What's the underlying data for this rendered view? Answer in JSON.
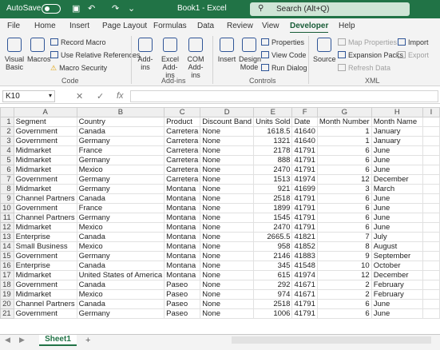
{
  "titlebar": {
    "autosave": "AutoSave",
    "toggle": "Off",
    "book": "Book1 - Excel",
    "search": "Search (Alt+Q)"
  },
  "tabs": [
    "File",
    "Home",
    "Insert",
    "Page Layout",
    "Formulas",
    "Data",
    "Review",
    "View",
    "Developer",
    "Help"
  ],
  "ribbon": {
    "code": {
      "vb": "Visual Basic",
      "macros": "Macros",
      "record": "Record Macro",
      "relative": "Use Relative References",
      "security": "Macro Security",
      "group": "Code"
    },
    "addins": {
      "addins": "Add-ins",
      "excel": "Excel Add-ins",
      "com": "COM Add-ins",
      "group": "Add-ins"
    },
    "controls": {
      "insert": "Insert",
      "design": "Design Mode",
      "properties": "Properties",
      "viewcode": "View Code",
      "rundialog": "Run Dialog",
      "group": "Controls"
    },
    "xml": {
      "source": "Source",
      "mapprops": "Map Properties",
      "expansion": "Expansion Packs",
      "refresh": "Refresh Data",
      "import": "Import",
      "export": "Export",
      "group": "XML"
    }
  },
  "formula_bar": {
    "namebox": "K10",
    "fx": "fx",
    "value": ""
  },
  "columns": [
    "A",
    "B",
    "C",
    "D",
    "E",
    "F",
    "G",
    "H",
    "I"
  ],
  "header_row": [
    "Segment",
    "Country",
    "Product",
    "Discount Band",
    "Units Sold",
    "Date",
    "Month Number",
    "Month Name"
  ],
  "rows": [
    [
      "Government",
      "Canada",
      "Carretera",
      "None",
      "1618.5",
      "41640",
      "1",
      "January"
    ],
    [
      "Government",
      "Germany",
      "Carretera",
      "None",
      "1321",
      "41640",
      "1",
      "January"
    ],
    [
      "Midmarket",
      "France",
      "Carretera",
      "None",
      "2178",
      "41791",
      "6",
      "June"
    ],
    [
      "Midmarket",
      "Germany",
      "Carretera",
      "None",
      "888",
      "41791",
      "6",
      "June"
    ],
    [
      "Midmarket",
      "Mexico",
      "Carretera",
      "None",
      "2470",
      "41791",
      "6",
      "June"
    ],
    [
      "Government",
      "Germany",
      "Carretera",
      "None",
      "1513",
      "41974",
      "12",
      "December"
    ],
    [
      "Midmarket",
      "Germany",
      "Montana",
      "None",
      "921",
      "41699",
      "3",
      "March"
    ],
    [
      "Channel Partners",
      "Canada",
      "Montana",
      "None",
      "2518",
      "41791",
      "6",
      "June"
    ],
    [
      "Government",
      "France",
      "Montana",
      "None",
      "1899",
      "41791",
      "6",
      "June"
    ],
    [
      "Channel Partners",
      "Germany",
      "Montana",
      "None",
      "1545",
      "41791",
      "6",
      "June"
    ],
    [
      "Midmarket",
      "Mexico",
      "Montana",
      "None",
      "2470",
      "41791",
      "6",
      "June"
    ],
    [
      "Enterprise",
      "Canada",
      "Montana",
      "None",
      "2665.5",
      "41821",
      "7",
      "July"
    ],
    [
      "Small Business",
      "Mexico",
      "Montana",
      "None",
      "958",
      "41852",
      "8",
      "August"
    ],
    [
      "Government",
      "Germany",
      "Montana",
      "None",
      "2146",
      "41883",
      "9",
      "September"
    ],
    [
      "Enterprise",
      "Canada",
      "Montana",
      "None",
      "345",
      "41548",
      "10",
      "October"
    ],
    [
      "Midmarket",
      "United States of America",
      "Montana",
      "None",
      "615",
      "41974",
      "12",
      "December"
    ],
    [
      "Government",
      "Canada",
      "Paseo",
      "None",
      "292",
      "41671",
      "2",
      "February"
    ],
    [
      "Midmarket",
      "Mexico",
      "Paseo",
      "None",
      "974",
      "41671",
      "2",
      "February"
    ],
    [
      "Channel Partners",
      "Canada",
      "Paseo",
      "None",
      "2518",
      "41791",
      "6",
      "June"
    ],
    [
      "Government",
      "Germany",
      "Paseo",
      "None",
      "1006",
      "41791",
      "6",
      "June"
    ]
  ],
  "sheet_tab": "Sheet1",
  "add_sheet": "+"
}
